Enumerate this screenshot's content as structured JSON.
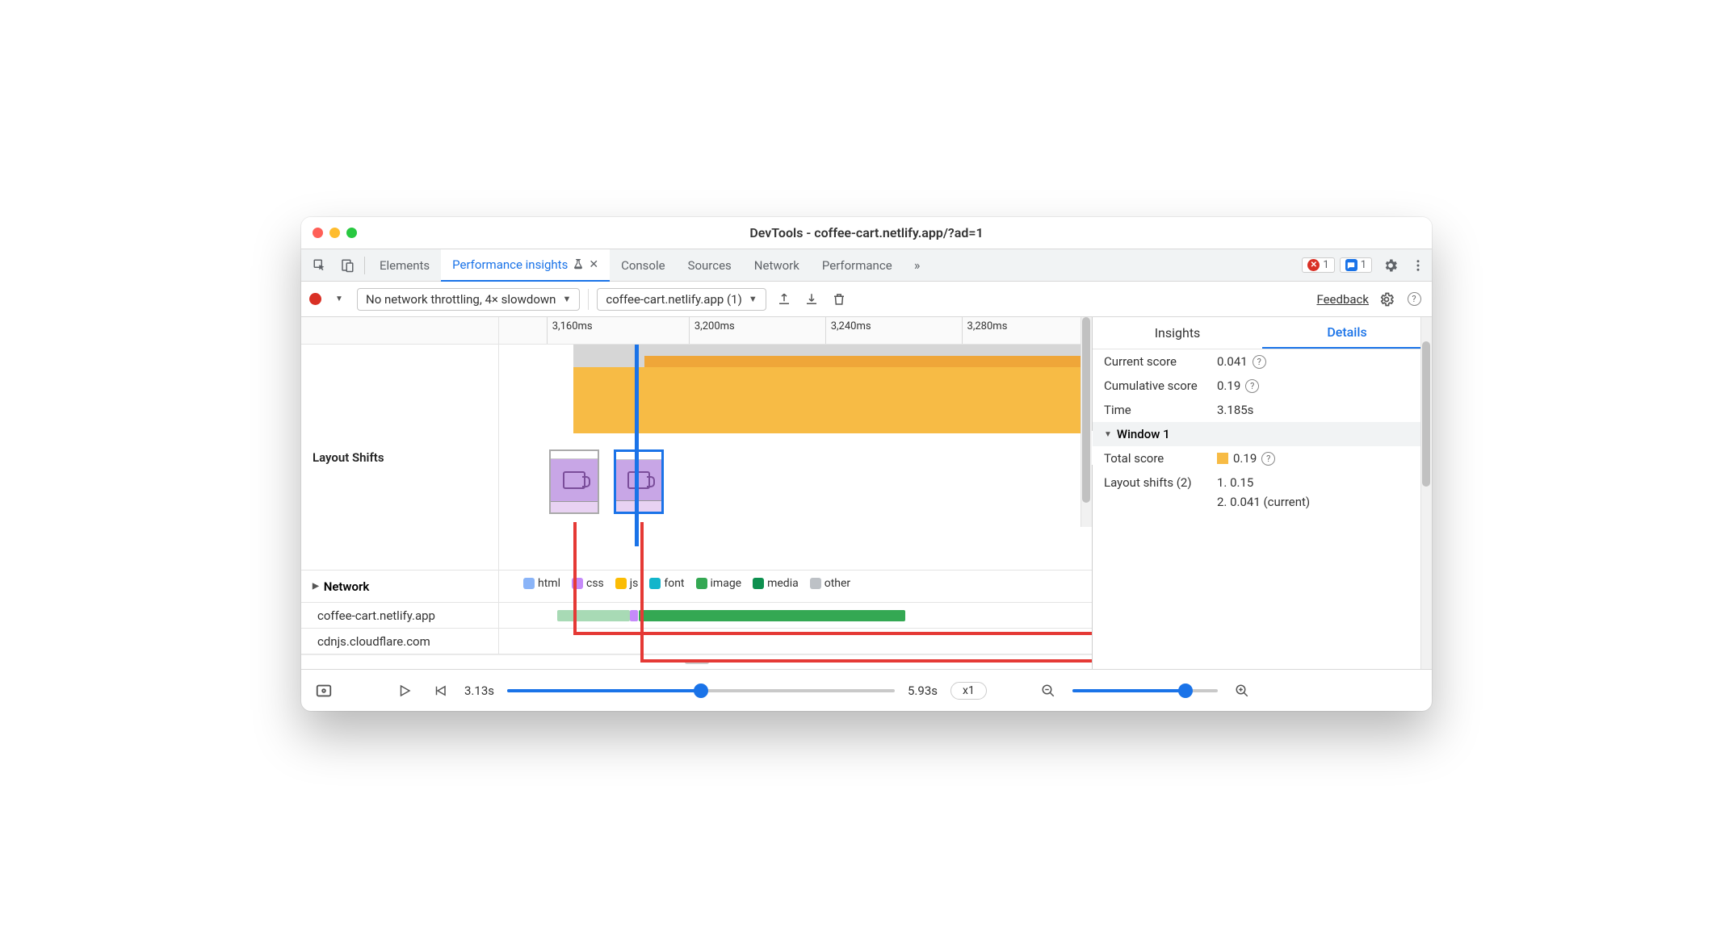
{
  "window": {
    "title": "DevTools - coffee-cart.netlify.app/?ad=1"
  },
  "tabstrip": {
    "tabs": [
      "Elements",
      "Performance insights",
      "Console",
      "Sources",
      "Network",
      "Performance"
    ],
    "activeIndex": 1,
    "errors": "1",
    "messages": "1"
  },
  "toolbar": {
    "throttling": "No network throttling, 4× slowdown",
    "target": "coffee-cart.netlify.app (1)",
    "feedback": "Feedback"
  },
  "ruler": {
    "ticks": [
      {
        "label": "3,160ms",
        "leftPct": 8
      },
      {
        "label": "3,200ms",
        "leftPct": 32
      },
      {
        "label": "3,240ms",
        "leftPct": 55
      },
      {
        "label": "3,280ms",
        "leftPct": 78
      }
    ]
  },
  "leftLabels": {
    "layoutShifts": "Layout Shifts",
    "network": "Network",
    "hosts": [
      "coffee-cart.netlify.app",
      "cdnjs.cloudflare.com"
    ]
  },
  "legend": [
    {
      "label": "html",
      "color": "#8ab4f8"
    },
    {
      "label": "css",
      "color": "#c58af9"
    },
    {
      "label": "js",
      "color": "#fbbc04"
    },
    {
      "label": "font",
      "color": "#12b5cb"
    },
    {
      "label": "image",
      "color": "#34a853"
    },
    {
      "label": "media",
      "color": "#0d904f"
    },
    {
      "label": "other",
      "color": "#bdc1c6"
    }
  ],
  "details": {
    "tabs": [
      "Insights",
      "Details"
    ],
    "activeIndex": 1,
    "currentScoreLabel": "Current score",
    "currentScore": "0.041",
    "cumulativeLabel": "Cumulative score",
    "cumulative": "0.19",
    "timeLabel": "Time",
    "time": "3.185s",
    "windowLabel": "Window 1",
    "totalScoreLabel": "Total score",
    "totalScore": "0.19",
    "shiftsLabel": "Layout shifts (2)",
    "shift1": "1. 0.15",
    "shift2": "2. 0.041 (current)"
  },
  "footer": {
    "start": "3.13s",
    "end": "5.93s",
    "speed": "x1",
    "timePct": 50,
    "zoomPct": 78
  },
  "colors": {
    "accent": "#1a73e8",
    "flame": "#f7bb45",
    "red": "#e53935"
  }
}
